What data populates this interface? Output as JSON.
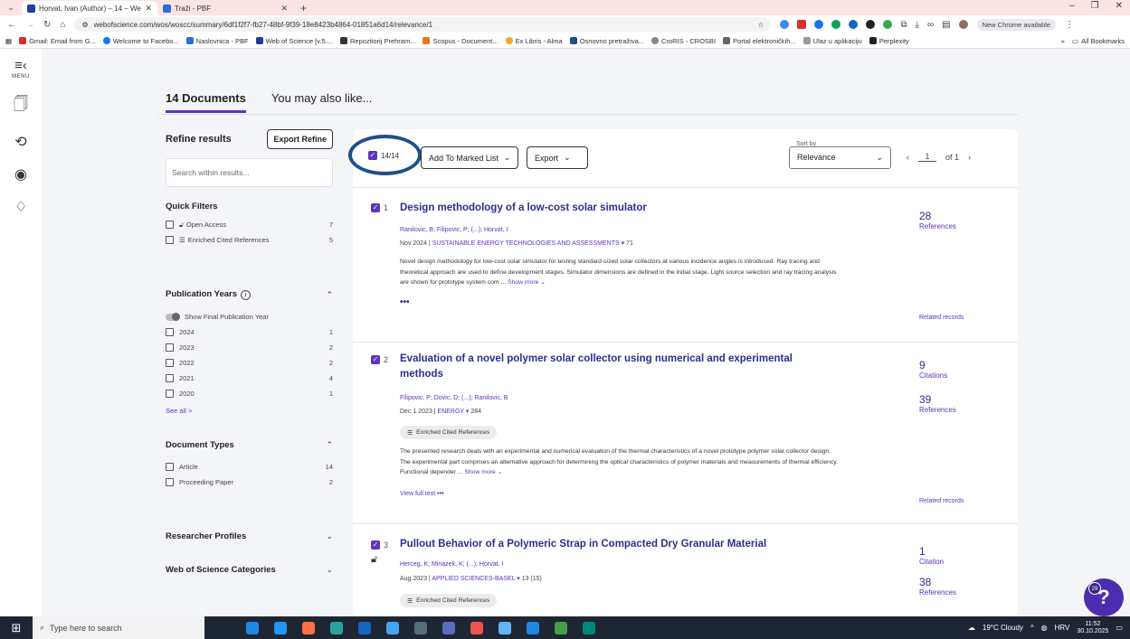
{
  "browser": {
    "tabs": [
      {
        "title": "Horvat, Ivan (Author) – 14 – We",
        "favicon_color": "#1c3f94",
        "active": true
      },
      {
        "title": "Traži - PBF",
        "favicon_color": "#2a6fd6",
        "active": false
      }
    ],
    "url": "webofscience.com/wos/woscc/summary/6df1f2f7-fb27-48bf-9f39-18e8423b4864-01851a6d14/relevance/1",
    "new_chrome": "New Chrome available",
    "bookmarks": [
      {
        "label": "Gmail: Email from G...",
        "color": "#d93025"
      },
      {
        "label": "Welcome to Facebo...",
        "color": "#1877f2"
      },
      {
        "label": "Naslovnica - PBF",
        "color": "#2a6fd6"
      },
      {
        "label": "Web of Science [v.5....",
        "color": "#1c3f94"
      },
      {
        "label": "Repozitorij Prehram...",
        "color": "#333333"
      },
      {
        "label": "Scopus - Document...",
        "color": "#e87722"
      },
      {
        "label": "Ex Libris - Alma",
        "color": "#f5a623"
      },
      {
        "label": "Osnovno pretraživa...",
        "color": "#1f4e8c"
      },
      {
        "label": "CroRIS - CROSBI",
        "color": "#888888"
      },
      {
        "label": "Portal elektroničkih...",
        "color": "#666666"
      },
      {
        "label": "Ulaz u aplikaciju",
        "color": "#999999"
      },
      {
        "label": "Perplexity",
        "color": "#222222"
      }
    ],
    "bookmarks_more": "»",
    "all_bookmarks": "All Bookmarks"
  },
  "rail": {
    "menu_label": "MENU"
  },
  "doc_tabs": {
    "documents": "14 Documents",
    "also_like": "You may also like..."
  },
  "refine": {
    "title": "Refine results",
    "export_refine": "Export Refine",
    "search_placeholder": "Search within results...",
    "quick_filters_title": "Quick Filters",
    "quick_filters": [
      {
        "label": "Open Access",
        "count": "7"
      },
      {
        "label": "Enriched Cited References",
        "count": "5"
      }
    ],
    "pub_years_title": "Publication Years",
    "show_final": "Show Final Publication Year",
    "years": [
      {
        "label": "2024",
        "count": "1"
      },
      {
        "label": "2023",
        "count": "2"
      },
      {
        "label": "2022",
        "count": "2"
      },
      {
        "label": "2021",
        "count": "4"
      },
      {
        "label": "2020",
        "count": "1"
      }
    ],
    "see_all": "See all >",
    "doc_types_title": "Document Types",
    "doc_types": [
      {
        "label": "Article",
        "count": "14"
      },
      {
        "label": "Proceeding Paper",
        "count": "2"
      }
    ],
    "researcher_profiles": "Researcher Profiles",
    "wos_categories": "Web of Science Categories"
  },
  "toolbar": {
    "selected": "14/14",
    "add_to_marked": "Add To Marked List",
    "export": "Export",
    "sort_label": "Sort by",
    "sort_value": "Relevance",
    "page": "1",
    "of_pages": "of 1"
  },
  "records": [
    {
      "num": "1",
      "title": "Design methodology of a low-cost solar simulator",
      "authors": "Ranilovic, B; Filipovic, P; (...); Horvat, I",
      "date": "Nov 2024 |",
      "journal": "SUSTAINABLE ENERGY TECHNOLOGIES AND ASSESSMENTS",
      "journal_count": "71",
      "abstract": "Novel design methodology for low-cost solar simulator for testing standard-sized solar collectors at various incidence angles is introduced. Ray tracing and theoretical approach are used to define development stages. Simulator dimensions are defined in the initial stage. Light source selection and ray tracing analysis are shown for prototype system com ...",
      "show_more": "Show more",
      "metric1_num": "28",
      "metric1_lbl": "References",
      "related": "Related records"
    },
    {
      "num": "2",
      "title": "Evaluation of a novel polymer solar collector using numerical and experimental methods",
      "authors": "Filipovic, P; Dovic, D; (...); Ranilovic, B",
      "date": "Dec 1 2023 |",
      "journal": "ENERGY",
      "journal_count": "284",
      "enriched": "Enriched Cited References",
      "abstract": "The presented research deals with an experimental and numerical evaluation of the thermal characteristics of a novel prototype polymer solar collector design. The experimental part comprises an alternative approach for determining the optical characteristics of polymer materials and measurements of thermal efficiency. Functional depender ...",
      "show_more": "Show more",
      "view_full": "View full text",
      "metric1_num": "9",
      "metric1_lbl": "Citations",
      "metric2_num": "39",
      "metric2_lbl": "References",
      "related": "Related records"
    },
    {
      "num": "3",
      "title": "Pullout Behavior of a Polymeric Strap in Compacted Dry Granular Material",
      "authors": "Herceg, K; Minazek, K; (...); Horvat, I",
      "date": "Aug 2023 |",
      "journal": "APPLIED SCIENCES-BASEL",
      "journal_count": "13 (15)",
      "enriched": "Enriched Cited References",
      "metric1_num": "1",
      "metric1_lbl": "Citation",
      "metric2_num": "38",
      "metric2_lbl": "References"
    }
  ],
  "help": {
    "badge": "29",
    "icon": "?"
  },
  "taskbar": {
    "search_placeholder": "Type here to search",
    "weather": "19°C Cloudy",
    "lang": "HRV",
    "time": "11:52",
    "date": "30.10.2025",
    "app_colors": [
      "#1e88e5",
      "#2196f3",
      "#ff7043",
      "#26a69a",
      "#1565c0",
      "#42a5f5",
      "#546e7a",
      "#5c6bc0",
      "#ef5350",
      "#64b5f6",
      "#1e88e5",
      "#43a047",
      "#00897b"
    ]
  }
}
